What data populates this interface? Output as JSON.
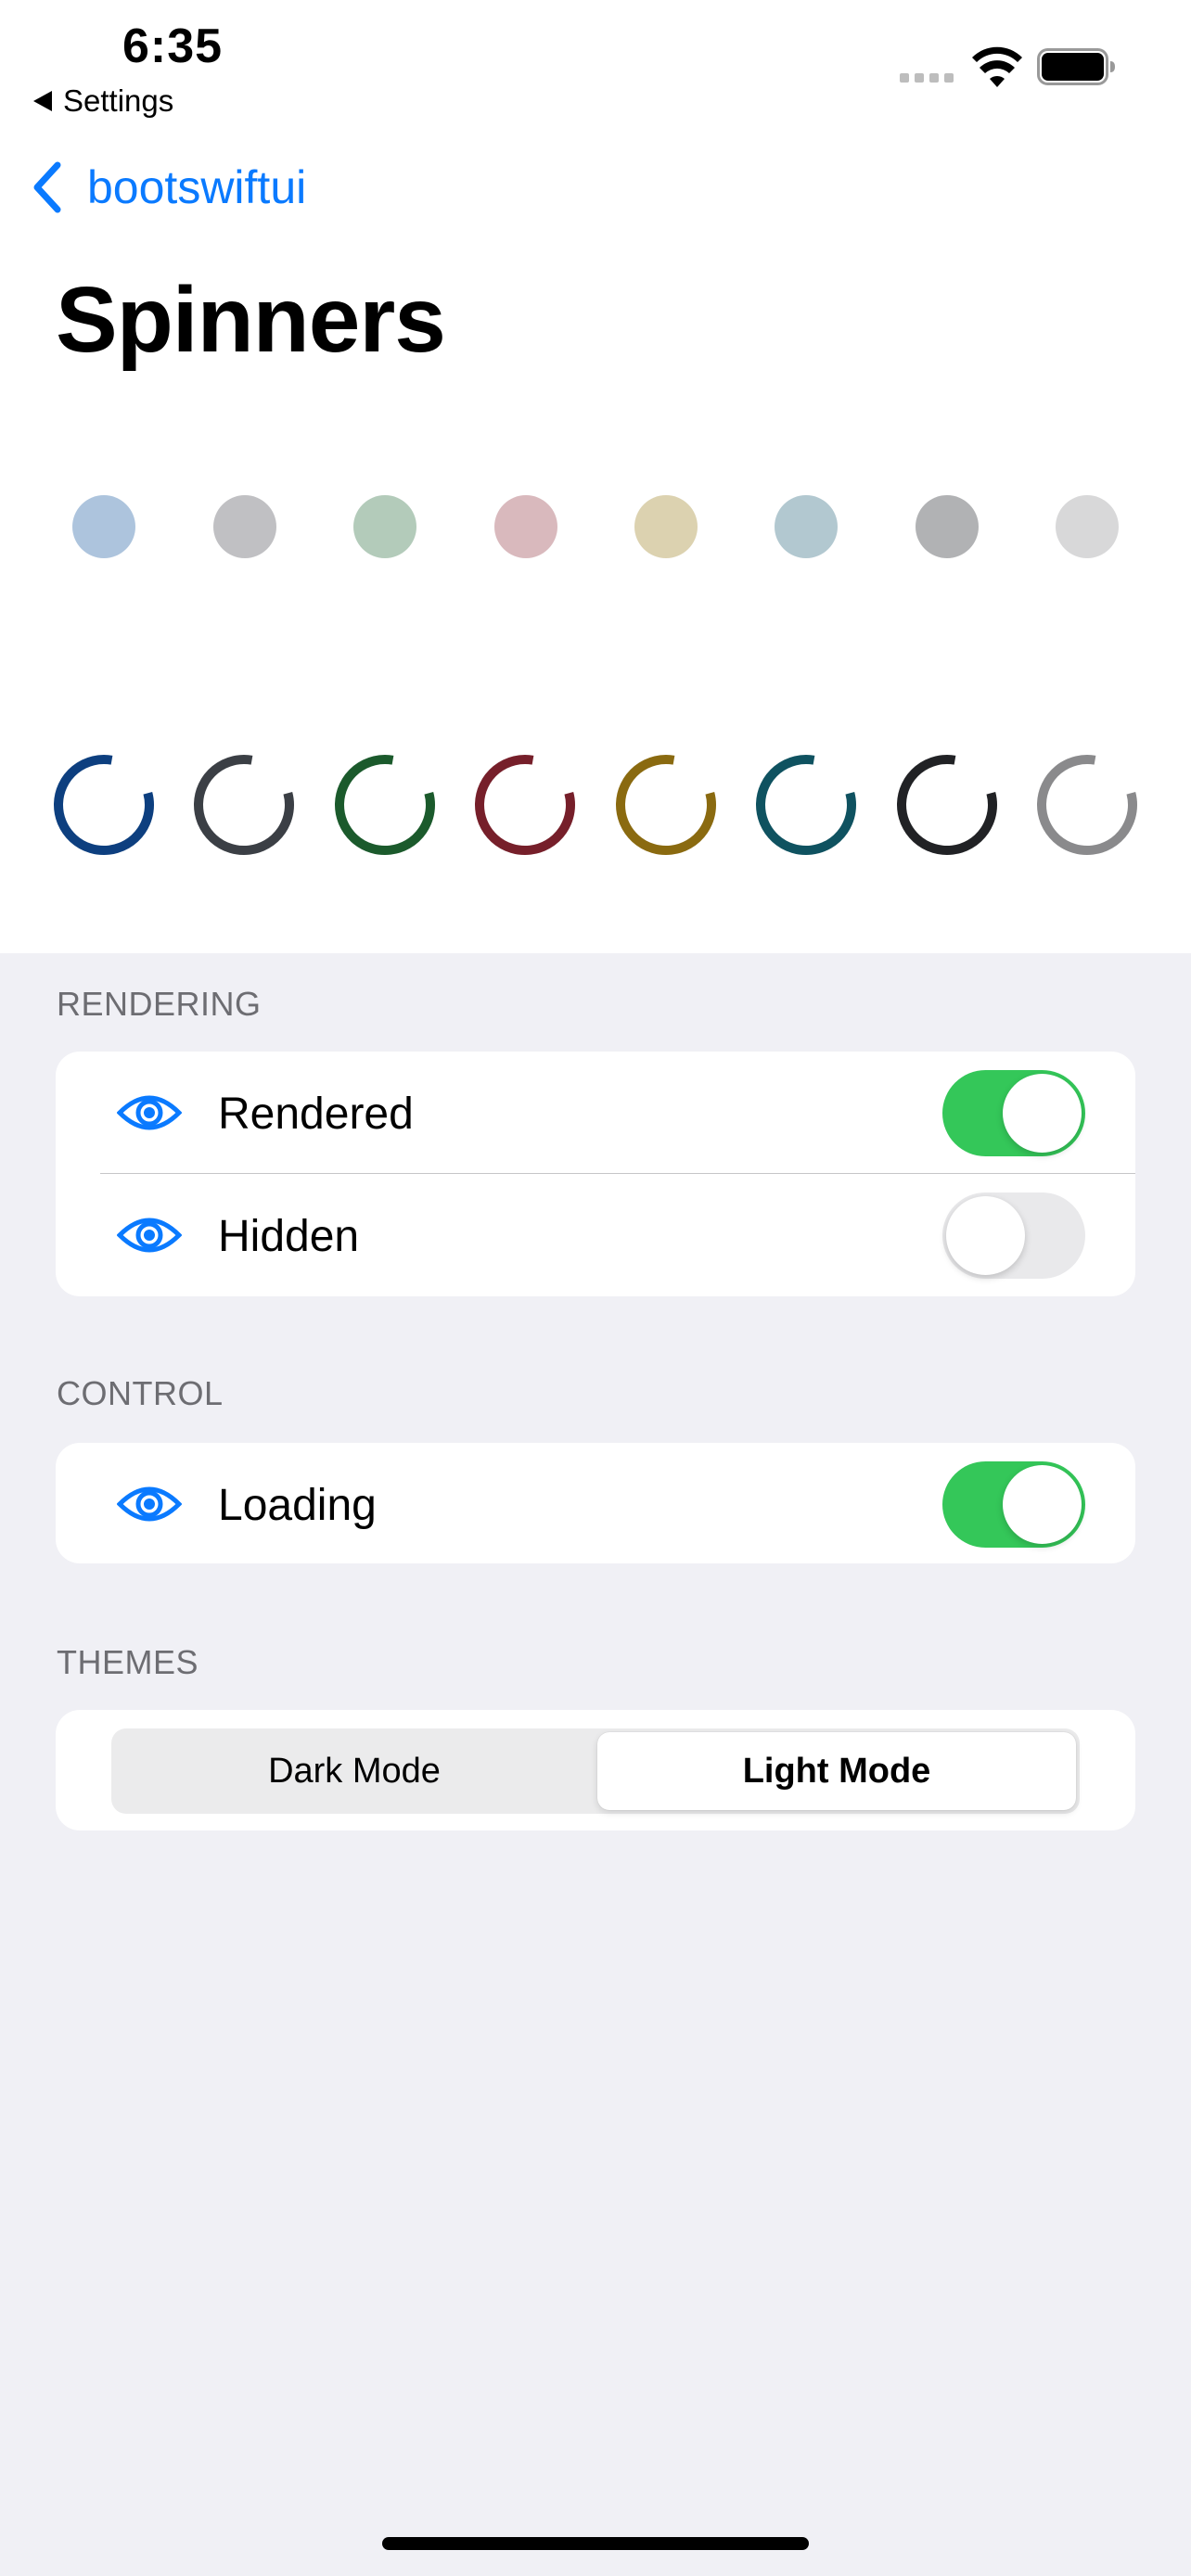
{
  "status_bar": {
    "time": "6:35",
    "back_label": "Settings"
  },
  "nav": {
    "back_label": "bootswiftui",
    "title": "Spinners"
  },
  "dots": [
    {
      "color": "#adc4dd"
    },
    {
      "color": "#c0c0c3"
    },
    {
      "color": "#b3cbba"
    },
    {
      "color": "#d9b9bd"
    },
    {
      "color": "#dcd2b0"
    },
    {
      "color": "#b2c8d0"
    },
    {
      "color": "#b1b2b4"
    },
    {
      "color": "#d8d8d9"
    }
  ],
  "spinners": [
    {
      "color": "#0d3f7f"
    },
    {
      "color": "#3b3f45"
    },
    {
      "color": "#1b5a2c"
    },
    {
      "color": "#761f2a"
    },
    {
      "color": "#8a6a10"
    },
    {
      "color": "#0f5260"
    },
    {
      "color": "#212225"
    },
    {
      "color": "#8a8a8c"
    }
  ],
  "rendering": {
    "header": "RENDERING",
    "rows": [
      {
        "label": "Rendered",
        "on": true
      },
      {
        "label": "Hidden",
        "on": false
      }
    ]
  },
  "control": {
    "header": "CONTROL",
    "rows": [
      {
        "label": "Loading",
        "on": true
      }
    ]
  },
  "themes": {
    "header": "THEMES",
    "options": [
      "Dark Mode",
      "Light Mode"
    ],
    "selected": "Light Mode"
  },
  "colors": {
    "accent": "#0a7aff",
    "toggle_on": "#34c759",
    "toggle_off": "#e9e9eb"
  }
}
